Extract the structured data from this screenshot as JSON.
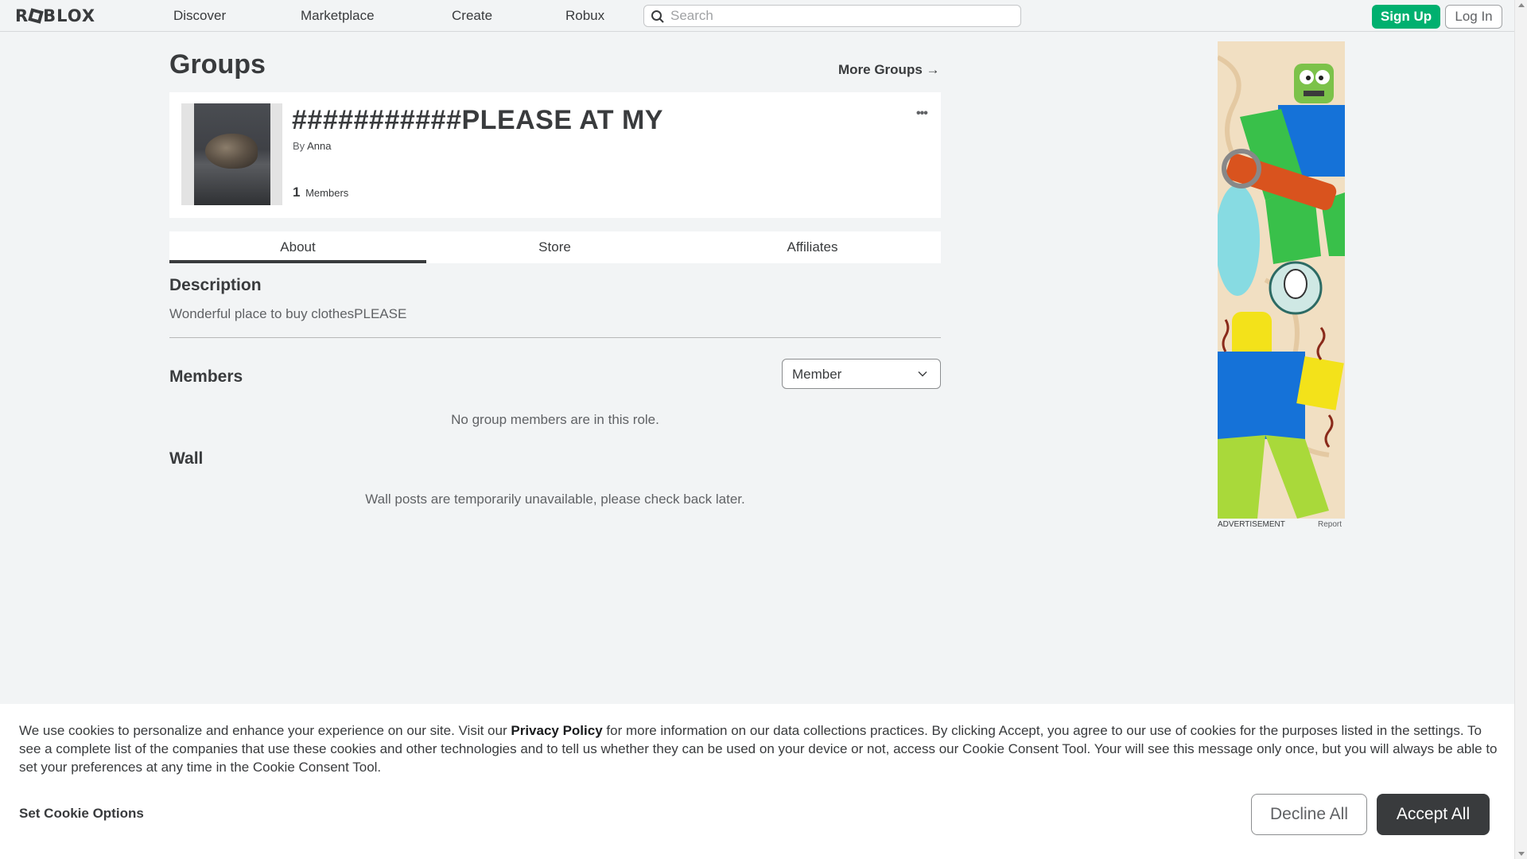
{
  "header": {
    "logo_text_1": "R",
    "logo_text_2": "BLOX",
    "nav": [
      "Discover",
      "Marketplace",
      "Create",
      "Robux"
    ],
    "search_placeholder": "Search",
    "signup_label": "Sign Up",
    "login_label": "Log In"
  },
  "page": {
    "title": "Groups",
    "more_groups": "More Groups →"
  },
  "group": {
    "name": "###########PLEASE AT MY",
    "by_label": "By",
    "owner": "Anna",
    "member_count": "1",
    "members_label": "Members",
    "more_icon": "•••"
  },
  "tabs": [
    "About",
    "Store",
    "Affiliates"
  ],
  "about": {
    "description_heading": "Description",
    "description_text": "Wonderful place to buy clothesPLEASE",
    "members_heading": "Members",
    "role_selected": "Member",
    "no_members": "No group members are in this role.",
    "wall_heading": "Wall",
    "wall_unavailable": "Wall posts are temporarily unavailable, please check back later."
  },
  "ad": {
    "label": "ADVERTISEMENT",
    "report": "Report"
  },
  "cookie": {
    "text_before": "We use cookies to personalize and enhance your experience on our site. Visit our ",
    "privacy_link": "Privacy Policy",
    "text_after": " for more information on our data collections practices. By clicking Accept, you agree to our use of cookies for the purposes listed in the settings. To see a complete list of the companies that use these cookies and other technologies and to tell us whether they can be used on your device or not, access our Cookie Consent Tool. Your will see this message only once, but you will always be able to set your preferences at any time in the Cookie Consent Tool.",
    "set_options": "Set Cookie Options",
    "decline": "Decline All",
    "accept": "Accept All"
  },
  "colors": {
    "background": "#f2f4f5",
    "signup_green": "#00b06f",
    "text_dark": "#393b3d",
    "accept_bg": "#393b3d"
  }
}
